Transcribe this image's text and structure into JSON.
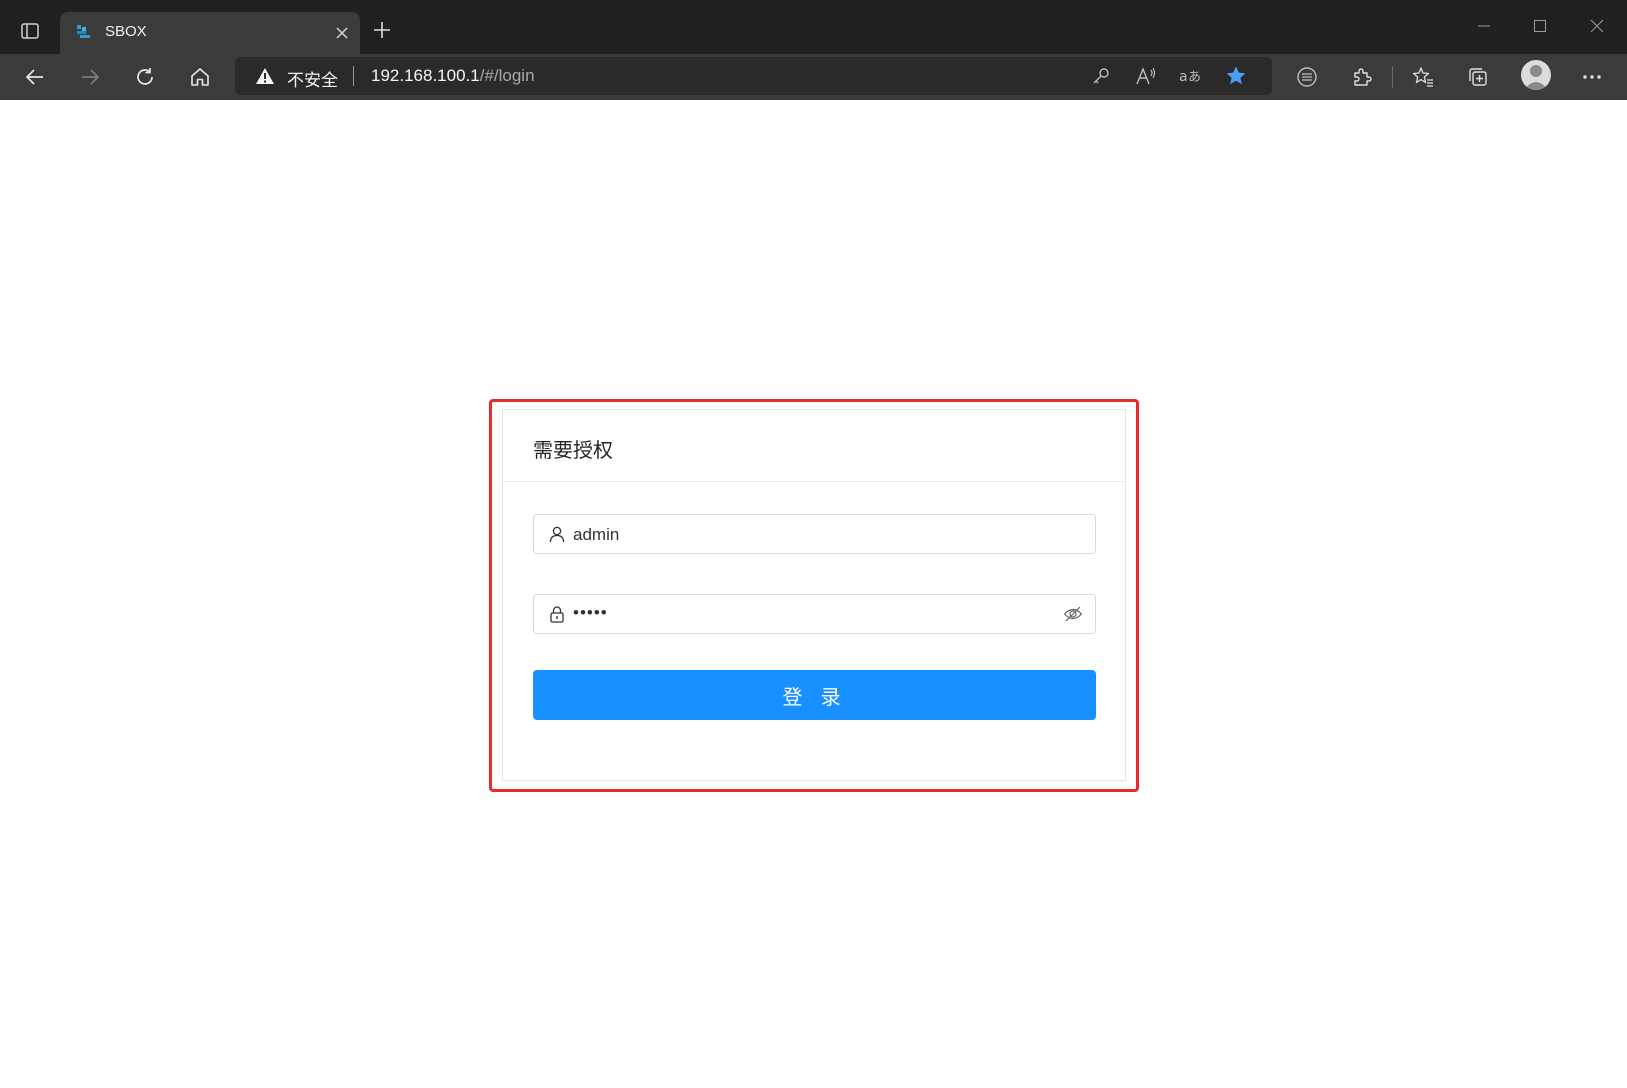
{
  "browser": {
    "tab": {
      "title": "SBOX"
    },
    "address": {
      "security_label": "不安全",
      "url_host": "192.168.100.1",
      "url_path": "/#/login"
    },
    "icons": {
      "tab_actions": "tab-actions-icon",
      "back": "back-arrow-icon",
      "forward": "forward-arrow-icon",
      "refresh": "refresh-icon",
      "home": "home-icon",
      "password": "key-icon",
      "read_aloud": "read-aloud-icon",
      "translate": "translate-icon",
      "favorite": "star-icon",
      "extensions": "puzzle-icon",
      "favorites": "favorites-icon",
      "collections": "collections-icon",
      "more": "more-icon"
    },
    "colors": {
      "favorite_star": "#4a9ff5"
    }
  },
  "login": {
    "title": "需要授权",
    "username": {
      "value": "admin"
    },
    "password": {
      "masked_value": "•••••"
    },
    "submit_label": "登 录"
  },
  "colors": {
    "primary_button": "#1890ff",
    "highlight_border": "#ea2b2b"
  }
}
